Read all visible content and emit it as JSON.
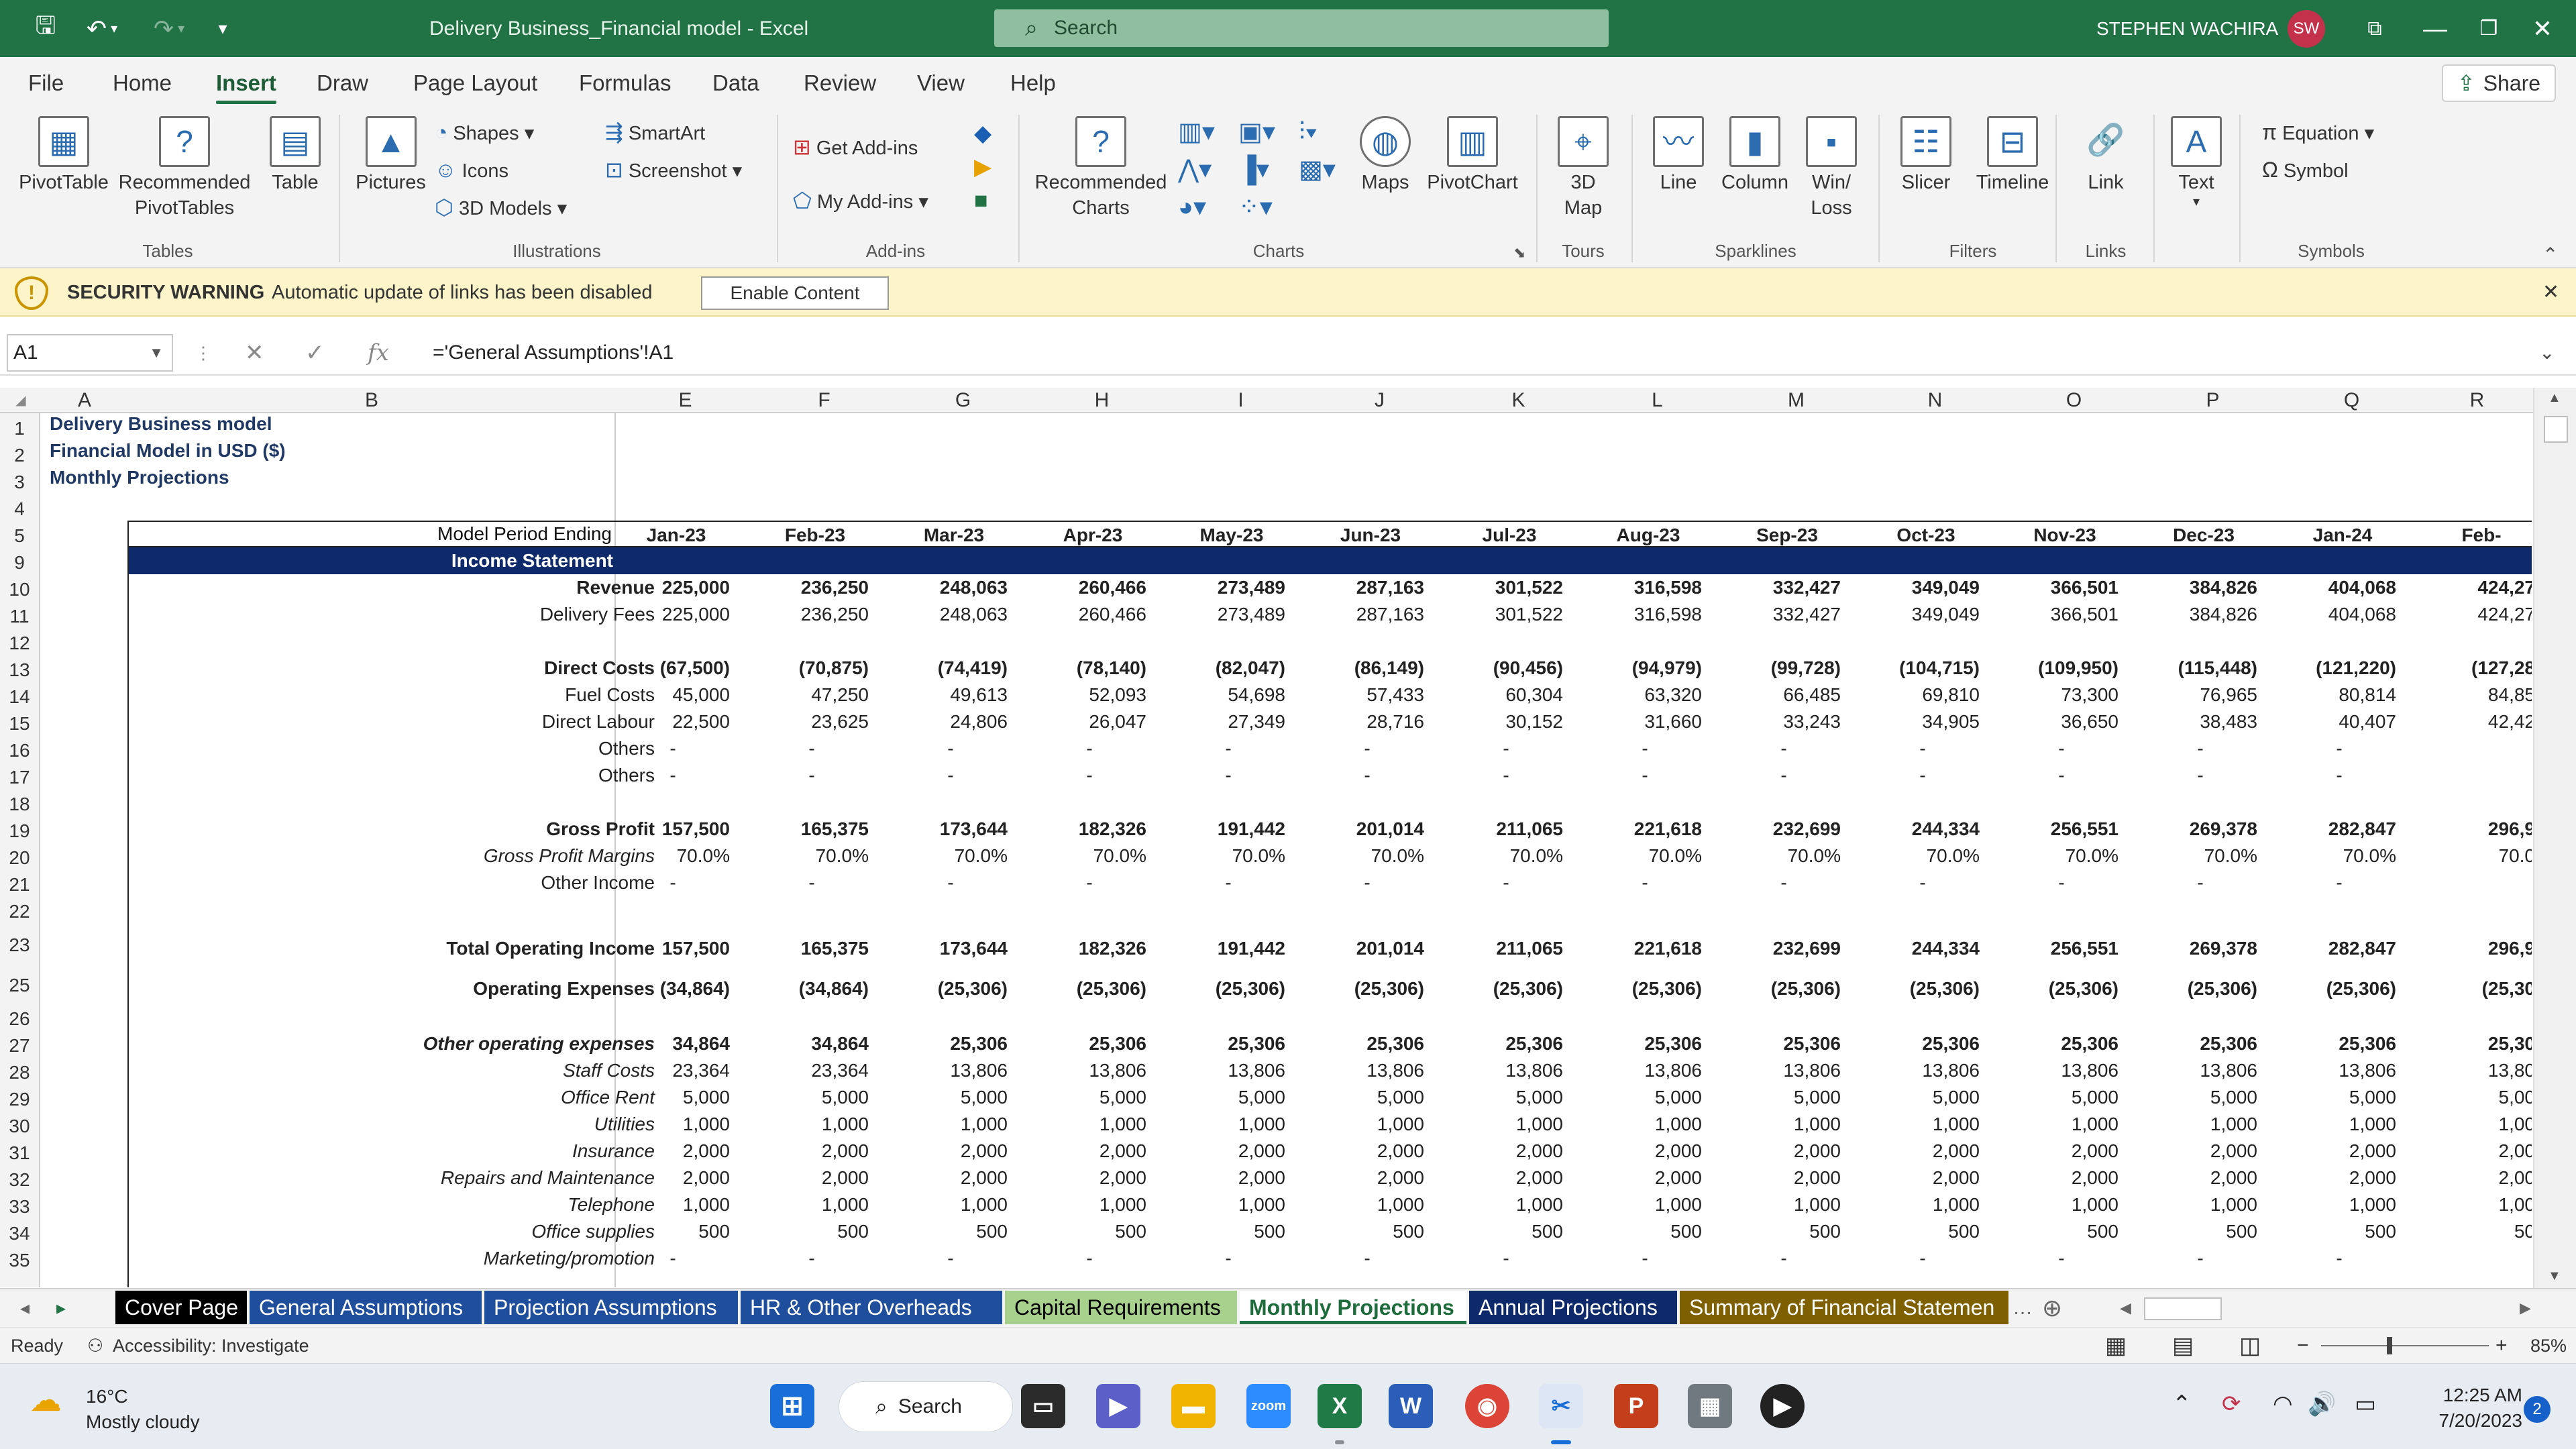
{
  "app": {
    "title": "Delivery Business_Financial model  -  Excel",
    "search_placeholder": "Search",
    "user_name": "STEPHEN WACHIRA",
    "user_initials": "SW",
    "share_label": "Share"
  },
  "ribbon_tabs": [
    "File",
    "Home",
    "Insert",
    "Draw",
    "Page Layout",
    "Formulas",
    "Data",
    "Review",
    "View",
    "Help"
  ],
  "active_tab": "Insert",
  "ribbon": {
    "pivottable": "PivotTable",
    "recommended_pivottables": "Recommended\nPivotTables",
    "table": "Table",
    "group_tables": "Tables",
    "pictures": "Pictures",
    "shapes": "Shapes",
    "icons": "Icons",
    "models3d": "3D Models",
    "smartart": "SmartArt",
    "screenshot": "Screenshot",
    "group_illustrations": "Illustrations",
    "get_addins": "Get Add-ins",
    "my_addins": "My Add-ins",
    "group_addins": "Add-ins",
    "recommended_charts": "Recommended\nCharts",
    "maps": "Maps",
    "pivotchart": "PivotChart",
    "group_charts": "Charts",
    "map3d": "3D\nMap",
    "group_tours": "Tours",
    "line": "Line",
    "column": "Column",
    "winloss": "Win/\nLoss",
    "group_sparklines": "Sparklines",
    "slicer": "Slicer",
    "timeline": "Timeline",
    "group_filters": "Filters",
    "link": "Link",
    "group_links": "Links",
    "text": "Text",
    "equation": "Equation",
    "symbol": "Symbol",
    "group_symbols": "Symbols"
  },
  "security": {
    "title": "SECURITY WARNING",
    "message": "Automatic update of links has been disabled",
    "button": "Enable Content"
  },
  "formula_bar": {
    "name_box": "A1",
    "formula": "='General Assumptions'!A1"
  },
  "columns": [
    "A",
    "B",
    "E",
    "F",
    "G",
    "H",
    "I",
    "J",
    "K",
    "L",
    "M",
    "N",
    "O",
    "P",
    "Q",
    "R"
  ],
  "rows": [
    "1",
    "2",
    "3",
    "4",
    "5",
    "9",
    "10",
    "11",
    "12",
    "13",
    "14",
    "15",
    "16",
    "17",
    "18",
    "19",
    "20",
    "21",
    "22",
    "23",
    "25",
    "26",
    "27",
    "28",
    "29",
    "30",
    "31",
    "32",
    "33",
    "34",
    "35"
  ],
  "header_text": {
    "line1": "Delivery Business model",
    "line2": "Financial  Model in USD ($)",
    "line3": "Monthly Projections"
  },
  "period_label": "Model Period Ending",
  "periods": [
    "Jan-23",
    "Feb-23",
    "Mar-23",
    "Apr-23",
    "May-23",
    "Jun-23",
    "Jul-23",
    "Aug-23",
    "Sep-23",
    "Oct-23",
    "Nov-23",
    "Dec-23",
    "Jan-24",
    "Feb-"
  ],
  "section_title": "Income Statement",
  "line_items": [
    {
      "row": "10",
      "label": "Revenue",
      "style": "b",
      "values": [
        "225,000",
        "236,250",
        "248,063",
        "260,466",
        "273,489",
        "287,163",
        "301,522",
        "316,598",
        "332,427",
        "349,049",
        "366,501",
        "384,826",
        "404,068",
        "424,27"
      ]
    },
    {
      "row": "11",
      "label": "Delivery Fees",
      "style": "",
      "values": [
        "225,000",
        "236,250",
        "248,063",
        "260,466",
        "273,489",
        "287,163",
        "301,522",
        "316,598",
        "332,427",
        "349,049",
        "366,501",
        "384,826",
        "404,068",
        "424,27"
      ]
    },
    {
      "row": "13",
      "label": "Direct Costs",
      "style": "b",
      "values": [
        "(67,500)",
        "(70,875)",
        "(74,419)",
        "(78,140)",
        "(82,047)",
        "(86,149)",
        "(90,456)",
        "(94,979)",
        "(99,728)",
        "(104,715)",
        "(109,950)",
        "(115,448)",
        "(121,220)",
        "(127,28"
      ]
    },
    {
      "row": "14",
      "label": "Fuel Costs",
      "style": "",
      "values": [
        "45,000",
        "47,250",
        "49,613",
        "52,093",
        "54,698",
        "57,433",
        "60,304",
        "63,320",
        "66,485",
        "69,810",
        "73,300",
        "76,965",
        "80,814",
        "84,85"
      ]
    },
    {
      "row": "15",
      "label": "Direct Labour",
      "style": "",
      "values": [
        "22,500",
        "23,625",
        "24,806",
        "26,047",
        "27,349",
        "28,716",
        "30,152",
        "31,660",
        "33,243",
        "34,905",
        "36,650",
        "38,483",
        "40,407",
        "42,42"
      ]
    },
    {
      "row": "16",
      "label": "Others",
      "style": "",
      "values": [
        "-",
        "-",
        "-",
        "-",
        "-",
        "-",
        "-",
        "-",
        "-",
        "-",
        "-",
        "-",
        "-",
        ""
      ]
    },
    {
      "row": "17",
      "label": "Others",
      "style": "",
      "values": [
        "-",
        "-",
        "-",
        "-",
        "-",
        "-",
        "-",
        "-",
        "-",
        "-",
        "-",
        "-",
        "-",
        ""
      ]
    },
    {
      "row": "19",
      "label": "Gross Profit",
      "style": "b",
      "values": [
        "157,500",
        "165,375",
        "173,644",
        "182,326",
        "191,442",
        "201,014",
        "211,065",
        "221,618",
        "232,699",
        "244,334",
        "256,551",
        "269,378",
        "282,847",
        "296,9"
      ]
    },
    {
      "row": "20",
      "label": "Gross Profit Margins",
      "style": "i",
      "values": [
        "70.0%",
        "70.0%",
        "70.0%",
        "70.0%",
        "70.0%",
        "70.0%",
        "70.0%",
        "70.0%",
        "70.0%",
        "70.0%",
        "70.0%",
        "70.0%",
        "70.0%",
        "70.0"
      ]
    },
    {
      "row": "21",
      "label": "Other Income",
      "style": "",
      "values": [
        "-",
        "-",
        "-",
        "-",
        "-",
        "-",
        "-",
        "-",
        "-",
        "-",
        "-",
        "-",
        "-",
        ""
      ]
    },
    {
      "row": "23",
      "label": "Total Operating Income",
      "style": "b",
      "values": [
        "157,500",
        "165,375",
        "173,644",
        "182,326",
        "191,442",
        "201,014",
        "211,065",
        "221,618",
        "232,699",
        "244,334",
        "256,551",
        "269,378",
        "282,847",
        "296,9"
      ]
    },
    {
      "row": "25",
      "label": "Operating Expenses",
      "style": "b",
      "values": [
        "(34,864)",
        "(34,864)",
        "(25,306)",
        "(25,306)",
        "(25,306)",
        "(25,306)",
        "(25,306)",
        "(25,306)",
        "(25,306)",
        "(25,306)",
        "(25,306)",
        "(25,306)",
        "(25,306)",
        "(25,30"
      ]
    },
    {
      "row": "27",
      "label": "Other operating expenses",
      "style": "b i",
      "values": [
        "34,864",
        "34,864",
        "25,306",
        "25,306",
        "25,306",
        "25,306",
        "25,306",
        "25,306",
        "25,306",
        "25,306",
        "25,306",
        "25,306",
        "25,306",
        "25,30"
      ]
    },
    {
      "row": "28",
      "label": "Staff Costs",
      "style": "i",
      "values": [
        "23,364",
        "23,364",
        "13,806",
        "13,806",
        "13,806",
        "13,806",
        "13,806",
        "13,806",
        "13,806",
        "13,806",
        "13,806",
        "13,806",
        "13,806",
        "13,80"
      ]
    },
    {
      "row": "29",
      "label": "Office Rent",
      "style": "i",
      "values": [
        "5,000",
        "5,000",
        "5,000",
        "5,000",
        "5,000",
        "5,000",
        "5,000",
        "5,000",
        "5,000",
        "5,000",
        "5,000",
        "5,000",
        "5,000",
        "5,00"
      ]
    },
    {
      "row": "30",
      "label": "Utilities",
      "style": "i",
      "values": [
        "1,000",
        "1,000",
        "1,000",
        "1,000",
        "1,000",
        "1,000",
        "1,000",
        "1,000",
        "1,000",
        "1,000",
        "1,000",
        "1,000",
        "1,000",
        "1,00"
      ]
    },
    {
      "row": "31",
      "label": "Insurance",
      "style": "i",
      "values": [
        "2,000",
        "2,000",
        "2,000",
        "2,000",
        "2,000",
        "2,000",
        "2,000",
        "2,000",
        "2,000",
        "2,000",
        "2,000",
        "2,000",
        "2,000",
        "2,00"
      ]
    },
    {
      "row": "32",
      "label": "Repairs and Maintenance",
      "style": "i",
      "values": [
        "2,000",
        "2,000",
        "2,000",
        "2,000",
        "2,000",
        "2,000",
        "2,000",
        "2,000",
        "2,000",
        "2,000",
        "2,000",
        "2,000",
        "2,000",
        "2,00"
      ]
    },
    {
      "row": "33",
      "label": "Telephone",
      "style": "i",
      "values": [
        "1,000",
        "1,000",
        "1,000",
        "1,000",
        "1,000",
        "1,000",
        "1,000",
        "1,000",
        "1,000",
        "1,000",
        "1,000",
        "1,000",
        "1,000",
        "1,00"
      ]
    },
    {
      "row": "34",
      "label": "Office supplies",
      "style": "i",
      "values": [
        "500",
        "500",
        "500",
        "500",
        "500",
        "500",
        "500",
        "500",
        "500",
        "500",
        "500",
        "500",
        "500",
        "50"
      ]
    },
    {
      "row": "35",
      "label": "Marketing/promotion",
      "style": "i",
      "values": [
        "-",
        "-",
        "-",
        "-",
        "-",
        "-",
        "-",
        "-",
        "-",
        "-",
        "-",
        "-",
        "-",
        ""
      ]
    }
  ],
  "sheet_tabs": [
    {
      "label": "Cover Page",
      "color": "#000000",
      "text": "#ffffff"
    },
    {
      "label": "General Assumptions",
      "color": "#1f4e9c",
      "text": "#ffffff"
    },
    {
      "label": "Projection Assumptions",
      "color": "#1f4e9c",
      "text": "#ffffff"
    },
    {
      "label": "HR & Other Overheads",
      "color": "#1f4e9c",
      "text": "#ffffff"
    },
    {
      "label": "Capital Requirements",
      "color": "#a9d18e",
      "text": "#000000"
    },
    {
      "label": "Monthly Projections",
      "color": "#ffffff",
      "text": "#1e6b3c"
    },
    {
      "label": "Annual Projections",
      "color": "#0e2a6b",
      "text": "#ffffff"
    },
    {
      "label": "Summary of Financial Statemen",
      "color": "#7f6000",
      "text": "#ffffff"
    }
  ],
  "active_sheet": "Monthly Projections",
  "status": {
    "ready": "Ready",
    "accessibility": "Accessibility: Investigate",
    "zoom": "85%"
  },
  "taskbar": {
    "temp": "16°C",
    "weather": "Mostly cloudy",
    "search": "Search",
    "time": "12:25 AM",
    "date": "7/20/2023",
    "notifications": "2"
  }
}
